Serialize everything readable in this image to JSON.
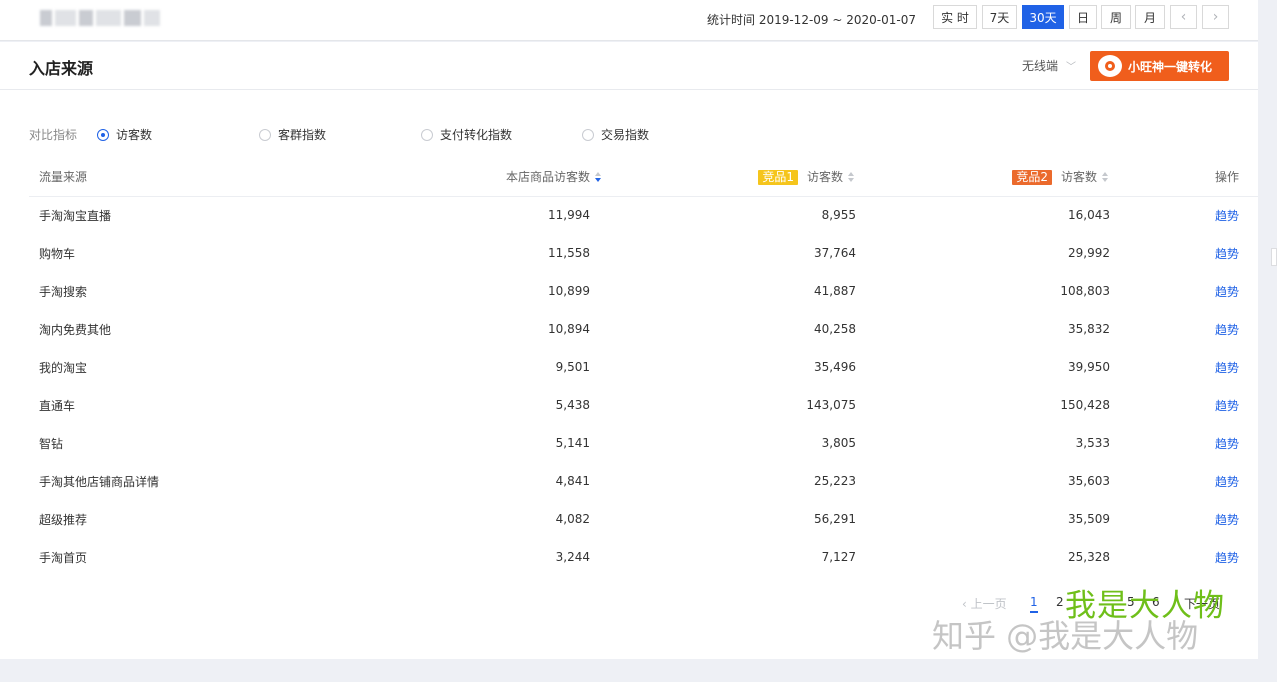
{
  "header": {
    "stat_label": "统计时间 2019-12-09 ~ 2020-01-07",
    "ranges": [
      "实 时",
      "7天",
      "30天",
      "日",
      "周",
      "月"
    ],
    "active_range": "30天",
    "prev_icon": "chevron-left-icon",
    "next_icon": "chevron-right-icon"
  },
  "panel": {
    "title": "入店来源",
    "device": "无线端",
    "convert_button": "小旺神一键转化"
  },
  "compare": {
    "label": "对比指标",
    "options": [
      "访客数",
      "客群指数",
      "支付转化指数",
      "交易指数"
    ],
    "selected": "访客数"
  },
  "table": {
    "headers": {
      "source": "流量来源",
      "mine": "本店商品访客数",
      "p1_tag": "竞品1",
      "p1": "访客数",
      "p2_tag": "竞品2",
      "p2": "访客数",
      "action": "操作"
    },
    "rows": [
      {
        "source": "手淘淘宝直播",
        "mine": "11,994",
        "p1": "8,955",
        "p2": "16,043",
        "action": "趋势"
      },
      {
        "source": "购物车",
        "mine": "11,558",
        "p1": "37,764",
        "p2": "29,992",
        "action": "趋势"
      },
      {
        "source": "手淘搜索",
        "mine": "10,899",
        "p1": "41,887",
        "p2": "108,803",
        "action": "趋势"
      },
      {
        "source": "淘内免费其他",
        "mine": "10,894",
        "p1": "40,258",
        "p2": "35,832",
        "action": "趋势"
      },
      {
        "source": "我的淘宝",
        "mine": "9,501",
        "p1": "35,496",
        "p2": "39,950",
        "action": "趋势"
      },
      {
        "source": "直通车",
        "mine": "5,438",
        "p1": "143,075",
        "p2": "150,428",
        "action": "趋势"
      },
      {
        "source": "智钻",
        "mine": "5,141",
        "p1": "3,805",
        "p2": "3,533",
        "action": "趋势"
      },
      {
        "source": "手淘其他店铺商品详情",
        "mine": "4,841",
        "p1": "25,223",
        "p2": "35,603",
        "action": "趋势"
      },
      {
        "source": "超级推荐",
        "mine": "4,082",
        "p1": "56,291",
        "p2": "35,509",
        "action": "趋势"
      },
      {
        "source": "手淘首页",
        "mine": "3,244",
        "p1": "7,127",
        "p2": "25,328",
        "action": "趋势"
      }
    ]
  },
  "pager": {
    "prev": "上一页",
    "pages": [
      "1",
      "2",
      "5",
      "6"
    ],
    "current": "1",
    "next": "下一页"
  },
  "watermark": {
    "line1": "我是大人物",
    "line2": "知乎 @我是大人物"
  },
  "colors": {
    "primary": "#2062e6",
    "orange": "#f05e1c",
    "tag1": "#f5c51c",
    "tag2": "#eb6a2c"
  }
}
